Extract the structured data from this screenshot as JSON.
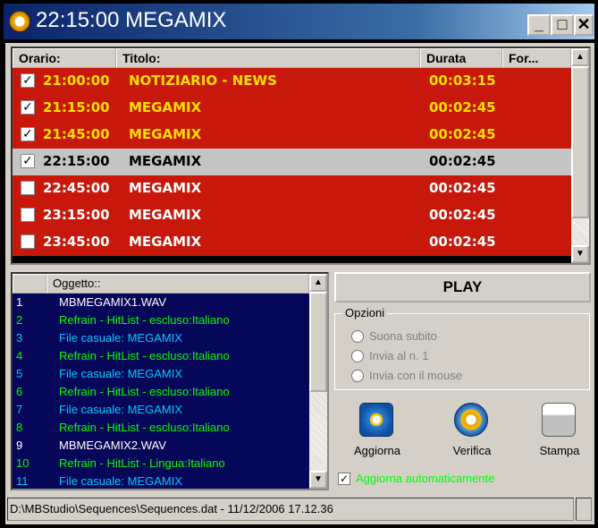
{
  "window": {
    "title": "22:15:00 MEGAMIX"
  },
  "icons": {
    "app": "clock-icon",
    "minimize": "minimize-icon",
    "maximize": "maximize-icon",
    "close": "close-icon",
    "refresh": "refresh-icon",
    "verify": "magnifier-clock-icon",
    "print": "printer-icon"
  },
  "top_list": {
    "headers": {
      "orario": "Orario:",
      "titolo": "Titolo:",
      "durata": "Durata",
      "formato": "For..."
    },
    "rows": [
      {
        "checked": true,
        "time": "21:00:00",
        "title": "NOTIZIARIO - NEWS",
        "duration": "00:03:15",
        "state": "past"
      },
      {
        "checked": true,
        "time": "21:15:00",
        "title": "MEGAMIX",
        "duration": "00:02:45",
        "state": "past"
      },
      {
        "checked": true,
        "time": "21:45:00",
        "title": "MEGAMIX",
        "duration": "00:02:45",
        "state": "past"
      },
      {
        "checked": true,
        "time": "22:15:00",
        "title": "MEGAMIX",
        "duration": "00:02:45",
        "state": "selected"
      },
      {
        "checked": false,
        "time": "22:45:00",
        "title": "MEGAMIX",
        "duration": "00:02:45",
        "state": "future"
      },
      {
        "checked": false,
        "time": "23:15:00",
        "title": "MEGAMIX",
        "duration": "00:02:45",
        "state": "future"
      },
      {
        "checked": false,
        "time": "23:45:00",
        "title": "MEGAMIX",
        "duration": "00:02:45",
        "state": "future"
      }
    ]
  },
  "bottom_list": {
    "header": "Oggetto::",
    "items": [
      {
        "num": "1",
        "text": "MBMEGAMIX1.WAV",
        "color": "#ffffff"
      },
      {
        "num": "2",
        "text": "Refrain - HitList - escluso:Italiano",
        "color": "#00ff00"
      },
      {
        "num": "3",
        "text": "File casuale: MEGAMIX",
        "color": "#00c8ff"
      },
      {
        "num": "4",
        "text": "Refrain - HitList - escluso:Italiano",
        "color": "#00ff00"
      },
      {
        "num": "5",
        "text": "File casuale: MEGAMIX",
        "color": "#00c8ff"
      },
      {
        "num": "6",
        "text": "Refrain - HitList - escluso:Italiano",
        "color": "#00ff00"
      },
      {
        "num": "7",
        "text": "File casuale: MEGAMIX",
        "color": "#00c8ff"
      },
      {
        "num": "8",
        "text": "Refrain - HitList - escluso:Italiano",
        "color": "#00ff00"
      },
      {
        "num": "9",
        "text": "MBMEGAMIX2.WAV",
        "color": "#ffffff"
      },
      {
        "num": "10",
        "text": "Refrain - HitList - Lingua:Italiano",
        "color": "#00ff00"
      },
      {
        "num": "11",
        "text": "File casuale: MEGAMIX",
        "color": "#00c8ff"
      }
    ]
  },
  "play_label": "PLAY",
  "options": {
    "legend": "Opzioni",
    "items": [
      "Suona subito",
      "Invia al n. 1",
      "Invia con il mouse"
    ]
  },
  "actions": {
    "aggiorna": "Aggiorna",
    "verifica": "Verifica",
    "stampa": "Stampa"
  },
  "auto_update": {
    "label": "Aggiorna automaticamente",
    "checked": true
  },
  "status_text": "D:\\MBStudio\\Sequences\\Sequences.dat - 11/12/2006 17.12.36"
}
